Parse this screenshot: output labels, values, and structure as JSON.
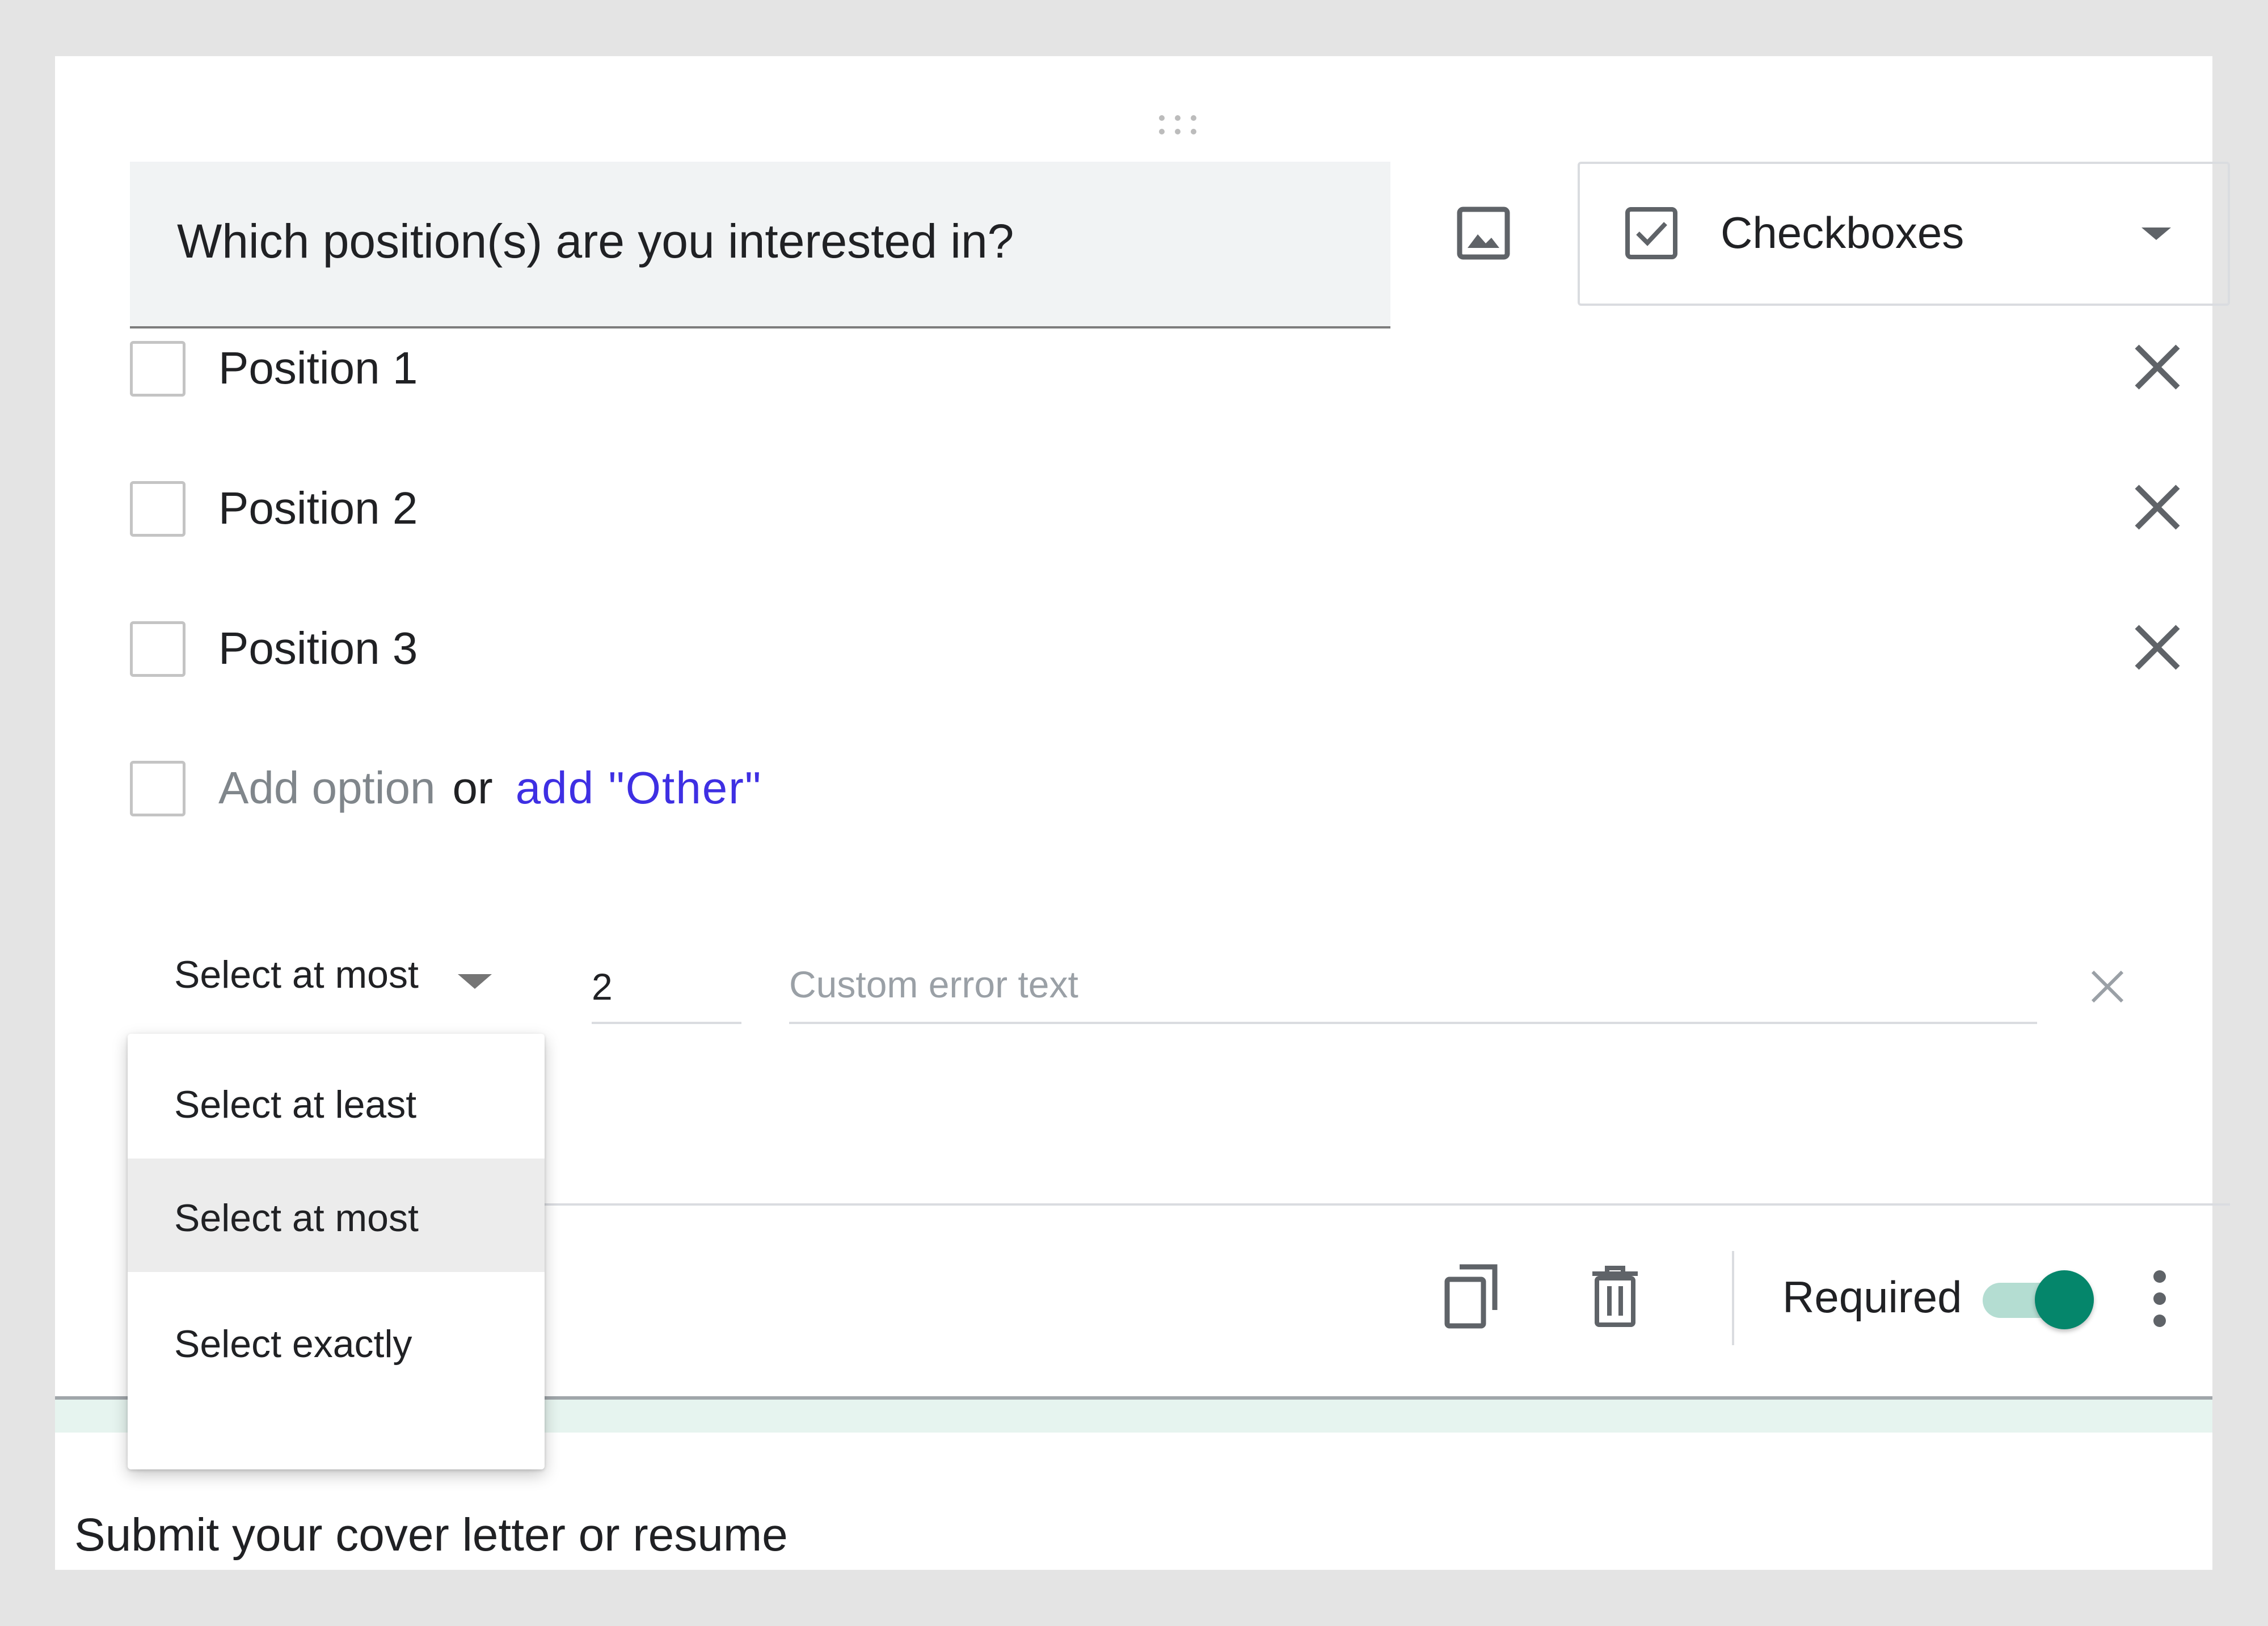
{
  "question": {
    "title": "Which position(s) are you interested in?"
  },
  "question_type": {
    "selected_label": "Checkboxes",
    "icon": "checkbox-checked-icon"
  },
  "options": [
    {
      "label": "Position 1"
    },
    {
      "label": "Position 2"
    },
    {
      "label": "Position 3"
    }
  ],
  "add_option": {
    "placeholder": "Add option",
    "or_text": "or",
    "add_other_label": "add \"Other\""
  },
  "validation": {
    "rule_selected": "Select at most",
    "number_value": "2",
    "error_placeholder": "Custom error text",
    "menu_options": [
      {
        "label": "Select at least"
      },
      {
        "label": "Select at most"
      },
      {
        "label": "Select exactly"
      }
    ],
    "menu_selected_index": 1
  },
  "footer": {
    "required_label": "Required",
    "required_on": true
  },
  "next_question": {
    "title": "Submit your cover letter or resume"
  },
  "colors": {
    "accent": "#05866b",
    "toggle_track": "#b4ddd2",
    "link": "#3e2fe3",
    "question_bg": "#f1f3f4"
  }
}
